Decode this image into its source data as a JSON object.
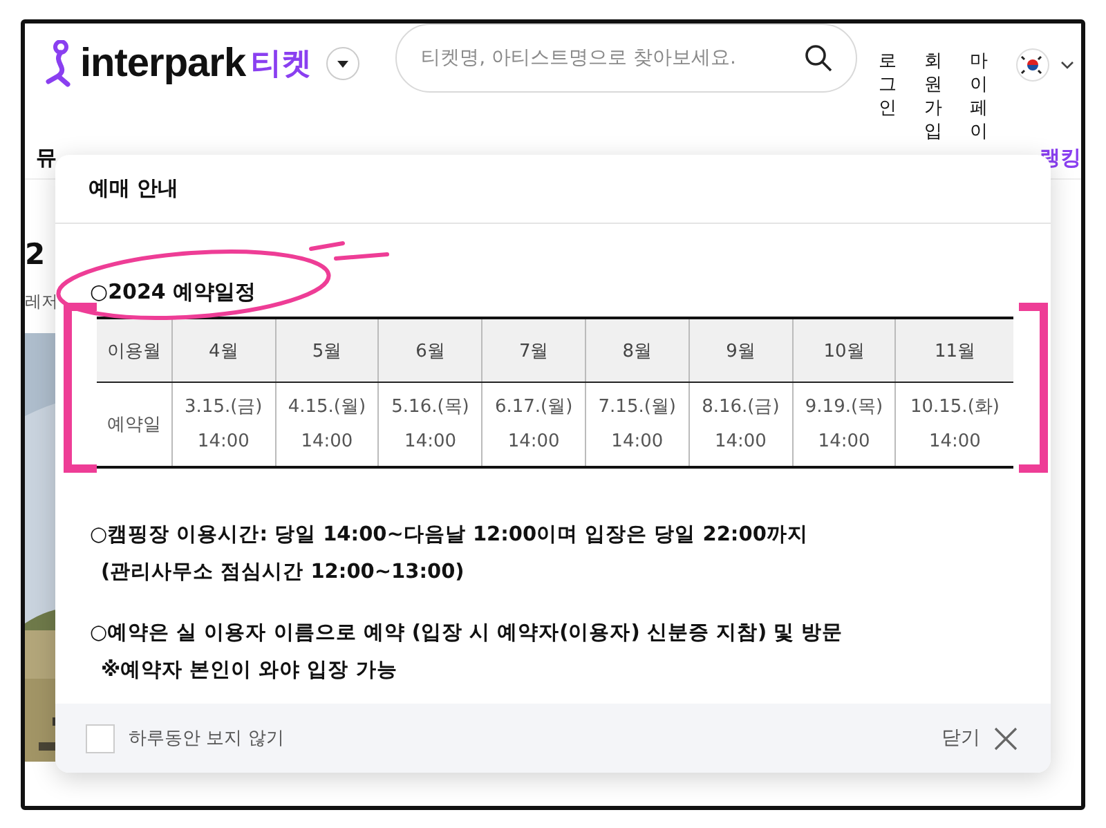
{
  "header": {
    "logo": "interpark",
    "logo_suffix": "티켓",
    "search": {
      "placeholder": "티켓명, 아티스트명으로 찾아보세요."
    },
    "links": [
      "로그인",
      "회원가입",
      "마이페이"
    ]
  },
  "nav": {
    "first_item": "뮤",
    "last_item": "랭킹"
  },
  "content": {
    "heading": "2",
    "category": "레저"
  },
  "modal": {
    "title": "예매 안내",
    "section_title": "○2024 예약일정",
    "table": {
      "columns": [
        "이용월",
        "4월",
        "5월",
        "6월",
        "7월",
        "8월",
        "9월",
        "10월",
        "11월"
      ],
      "rows": [
        [
          "예약일",
          "3.15.(금)\n14:00",
          "4.15.(월)\n14:00",
          "5.16.(목)\n14:00",
          "6.17.(월)\n14:00",
          "7.15.(월)\n14:00",
          "8.16.(금)\n14:00",
          "9.19.(목)\n14:00",
          "10.15.(화)\n14:00"
        ]
      ]
    },
    "notes": [
      [
        "○캠핑장 이용시간: 당일 14:00~다음날 12:00이며 입장은 당일 22:00까지",
        "(관리사무소 점심시간 12:00~13:00)"
      ],
      [
        "○예약은 실 이용자 이름으로 예약 (입장 시 예약자(이용자) 신분증 지참) 및 방문",
        "※예약자 본인이 와야 입장 가능"
      ]
    ],
    "footer": {
      "hide_today": {
        "label": "하루동안 보지 않기",
        "checked": false
      },
      "close_label": "닫기"
    }
  }
}
